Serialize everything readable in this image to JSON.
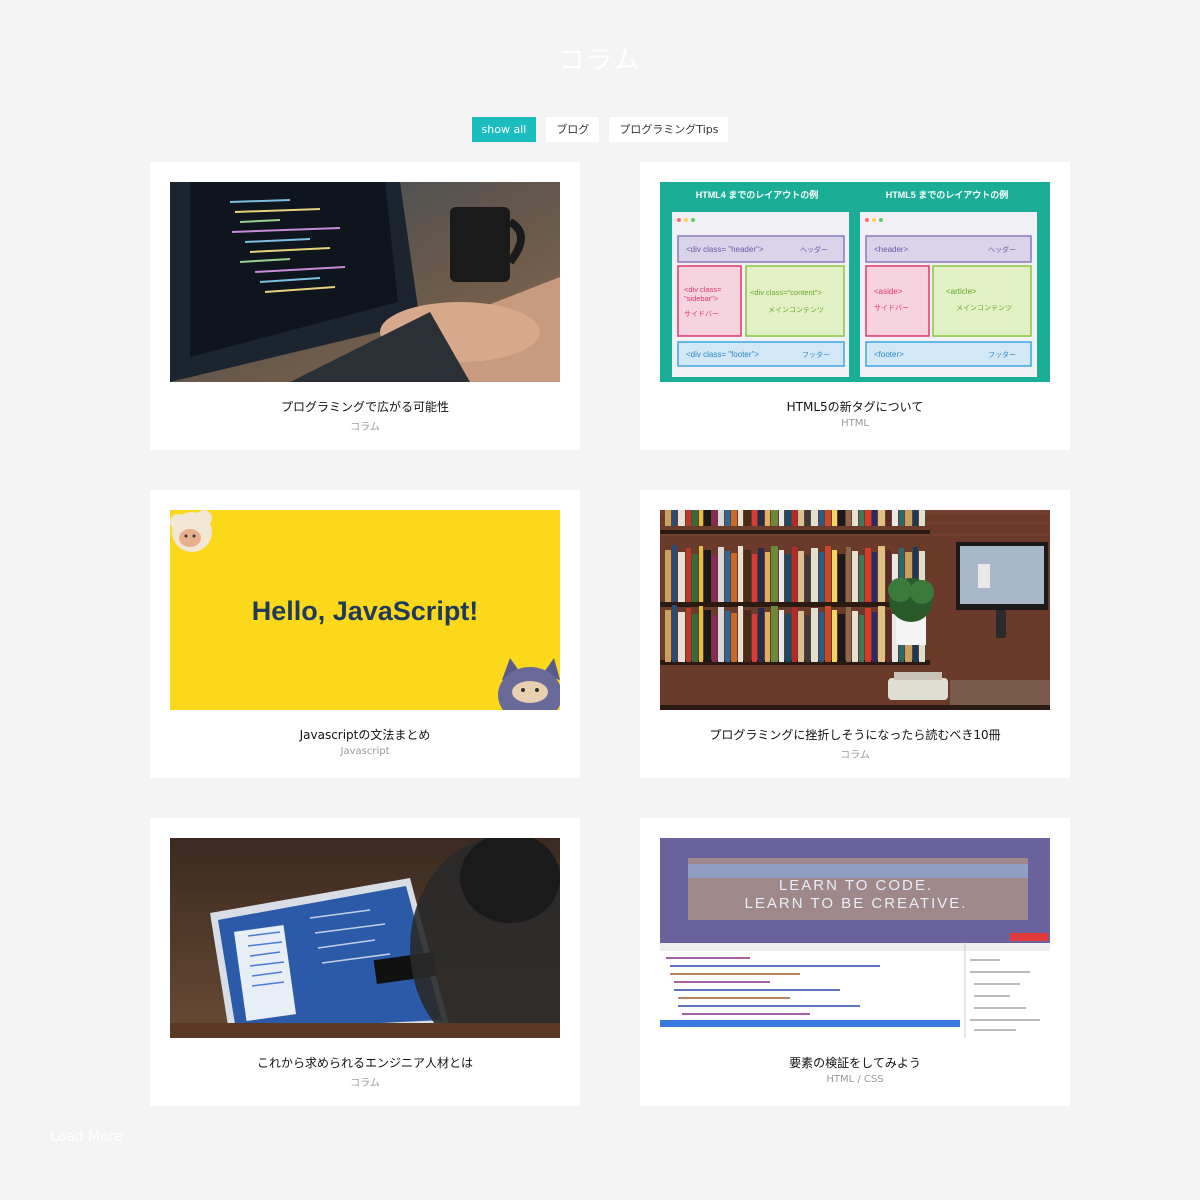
{
  "page": {
    "title": "コラム"
  },
  "filters": [
    {
      "label": "show all",
      "active": true
    },
    {
      "label": "ブログ",
      "active": false
    },
    {
      "label": "プログラミングTips",
      "active": false
    }
  ],
  "cards": [
    {
      "title": "プログラミングで広がる可能性",
      "category": "コラム"
    },
    {
      "title": "HTML5の新タグについて",
      "category": "HTML",
      "thumb": {
        "left_heading": "HTML4 までのレイアウトの例",
        "right_heading": "HTML5 までのレイアウトの例",
        "left_header": "<div class= \"header\">",
        "left_header_note": "ヘッダー",
        "left_sidebar_line1": "<div class=",
        "left_sidebar_line2": "\"sidebar\">",
        "left_sidebar_note": "サイドバー",
        "left_content": "<div class=\"content\">",
        "left_content_note": "メインコンテンツ",
        "left_footer": "<div class= \"footer\">",
        "left_footer_note": "フッター",
        "right_header": "<header>",
        "right_header_note": "ヘッダー",
        "right_aside": "<aside>",
        "right_aside_note": "サイドバー",
        "right_article": "<article>",
        "right_article_note": "メインコンテンツ",
        "right_footer": "<footer>",
        "right_footer_note": "フッター"
      }
    },
    {
      "title": "Javascriptの文法まとめ",
      "category": "Javascript",
      "thumb": {
        "text": "Hello, JavaScript!"
      }
    },
    {
      "title": "プログラミングに挫折しそうになったら読むべき10冊",
      "category": "コラム"
    },
    {
      "title": "これから求められるエンジニア人材とは",
      "category": "コラム"
    },
    {
      "title": "要素の検証をしてみよう",
      "category": "HTML / CSS",
      "thumb": {
        "line1": "LEARN TO CODE.",
        "line2": "LEARN TO BE CREATIVE."
      }
    }
  ],
  "load_more": "Load More",
  "colors": {
    "accent": "#1bbdbe",
    "background": "#f4f4f4",
    "html_thumb_bg": "#1aae97",
    "js_thumb_bg": "#fcd81b"
  }
}
